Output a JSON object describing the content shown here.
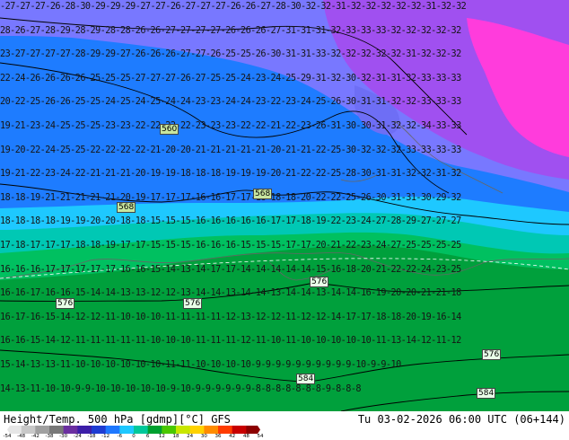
{
  "footer": {
    "title": "Height/Temp. 500 hPa [gdmp][°C] GFS",
    "valid": "Tu 03-02-2026 06:00 UTC (06+144)"
  },
  "colorbar": {
    "ticks": [
      "-54",
      "-48",
      "-42",
      "-38",
      "-30",
      "-24",
      "-18",
      "-12",
      "-6",
      "0",
      "6",
      "12",
      "18",
      "24",
      "30",
      "36",
      "42",
      "48",
      "54"
    ],
    "colors": [
      "#e6e6e6",
      "#c8c8c8",
      "#a0a0a0",
      "#787878",
      "#6b2fa0",
      "#3c1ea8",
      "#1e3cd2",
      "#1e78ff",
      "#1ec8ff",
      "#00c89b",
      "#00a030",
      "#4ac800",
      "#c8e600",
      "#ffd200",
      "#ff8c00",
      "#ff3c00",
      "#c80000",
      "#8c0000"
    ]
  },
  "map_colors": {
    "cold_magenta": "#ff3cdc",
    "purple": "#a050f0",
    "violet": "#7878ff",
    "blue": "#1e7cff",
    "cyan": "#1ec8ff",
    "teal": "#00c8b4",
    "green_light": "#00c060",
    "green": "#00a03c",
    "green_dark": "#009632"
  },
  "contour_labels": [
    "560",
    "568",
    "568",
    "576",
    "576",
    "576",
    "584",
    "584",
    "576",
    "584"
  ],
  "temperature_rows": [
    "-27-27-27-26-28-30-29-29-29-27-27-26-27-27-27-26-26-27-28-30-32-32-31-32-32-32-32-32-31-32-32",
    "28-26-27-28-29-28-29-28-28-26-26-27-27-27-27-26-26-26-27-31-31-31-32-33-33-33-32-32-32-32-32",
    "23-27-27-27-27-28-29-29-27-26-26-26-27-27-26-25-25-26-30-31-31-33-32-32-32-32-32-31-32-32-32",
    "22-24-26-26-26-26-25-25-25-27-27-27-26-27-25-25-24-23-24-25-29-31-32-30-32-31-31-32-33-33-33",
    "20-22-25-26-26-25-25-24-25-24-25-24-24-23-23-24-24-23-22-23-24-25-26-30-31-31-32-32-33-33-33",
    "19-21-23-24-25-25-25-23-23-22-22-22-22-23-23-23-22-22-21-22-23-26-31-30-30-31-32-32-34-33-33",
    "19-20-22-24-25-25-22-22-22-22-21-20-20-21-21-21-21-21-20-21-21-22-25-30-32-32-32-33-33-33-33",
    "19-21-22-23-24-22-21-21-21-20-19-19-18-18-18-19-19-19-20-21-22-22-25-28-30-31-31-32-32-31-32",
    "18-18-19-21-21-21-21-21-20-19-17-17-17-16-16-17-17-18-18-18-20-22-22-25-26-30-31-31-30-29-32",
    "18-18-18-18-19-19-20-20-18-18-15-15-15-16-16-16-16-16-17-17-18-19-22-23-24-27-28-29-27-27-27",
    "17-18-17-17-17-18-18-19-17-17-15-15-15-16-16-16-15-15-15-17-17-20-21-22-23-24-27-25-25-25-25",
    "16-16-16-17-17-17-17-17-16-16-15-14-13-14-17-17-14-14-14-14-14-15-16-18-20-21-22-22-24-23-25",
    "16-16-17-16-16-15-14-14-13-13-12-12-13-14-14-13-14-14-13-14-14-13-14-14-16-19-20-20-21-21-18",
    "16-17-16-15-14-12-12-11-10-10-10-11-11-11-11-12-13-12-12-11-12-12-14-17-17-18-18-20-19-16-14",
    "16-16-15-14-12-11-11-11-11-11-10-10-10-11-11-11-12-11-10-11-10-10-10-10-10-11-13-14-12-11-12",
    "15-14-13-13-11-10-10-10-10-10-10-11-11-10-10-10-10-9-9-9-9-9-9-9-9-9-9-10-9-9-10",
    "14-13-11-10-10-9-9-10-10-10-10-10-9-10-9-9-9-9-9-9-8-8-8-8-8-8-8-9-8-8-8"
  ]
}
